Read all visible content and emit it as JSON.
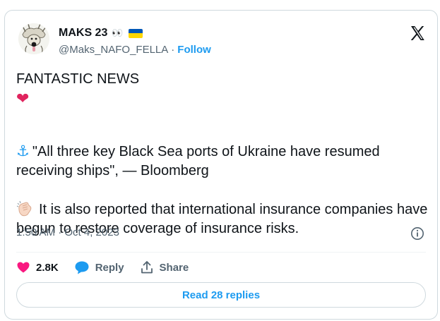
{
  "author": {
    "display_name": "MAKS 23",
    "eyes_emoji": "👀",
    "handle": "@Maks_NAFO_FELLA",
    "separator": "·",
    "follow_label": "Follow"
  },
  "tweet": {
    "line1": "FANTASTIC NEWS ",
    "heart": "❤",
    "anchor": "⚓",
    "quote": "\"All three key Black Sea ports of Ukraine have resumed receiving ships\", — Bloomberg",
    "report": "It is also reported that international insurance companies have begun to restore coverage of insurance risks."
  },
  "meta": {
    "timestamp": "1:50 AM · Oct 4, 2023"
  },
  "actions": {
    "likes": "2.8K",
    "reply_label": "Reply",
    "share_label": "Share"
  },
  "read_replies_label": "Read 28 replies",
  "colors": {
    "accent": "#1d9bf0",
    "heart": "#f91880",
    "text": "#0f1419",
    "muted": "#536471",
    "flag_blue": "#0057b7",
    "flag_yellow": "#ffd700"
  }
}
